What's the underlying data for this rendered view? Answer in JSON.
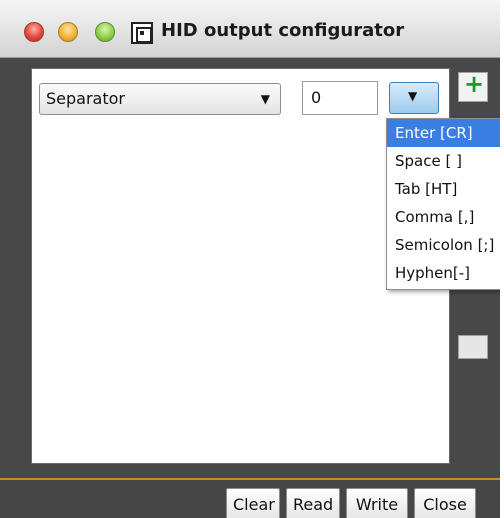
{
  "window": {
    "title": "HID output configurator",
    "app_icon": "concentric-square-icon"
  },
  "separator_row": {
    "type_value": "Separator",
    "count_value": "0",
    "selected_option": "Enter [CR]"
  },
  "dropdown": {
    "items": [
      {
        "label": "Enter [CR]"
      },
      {
        "label": "Space [ ]"
      },
      {
        "label": "Tab [HT]"
      },
      {
        "label": "Comma [,]"
      },
      {
        "label": "Semicolon [;]"
      },
      {
        "label": "Hyphen[-]"
      }
    ]
  },
  "side_buttons": {
    "add_icon": "plus-icon",
    "add_color": "#1a9a2a"
  },
  "footer": {
    "clear_label": "Clear",
    "read_label": "Read",
    "write_label": "Write",
    "close_label": "Close"
  },
  "colors": {
    "accent": "#3b7ee2",
    "frame": "#484848",
    "separator_line": "#c98a2e"
  }
}
